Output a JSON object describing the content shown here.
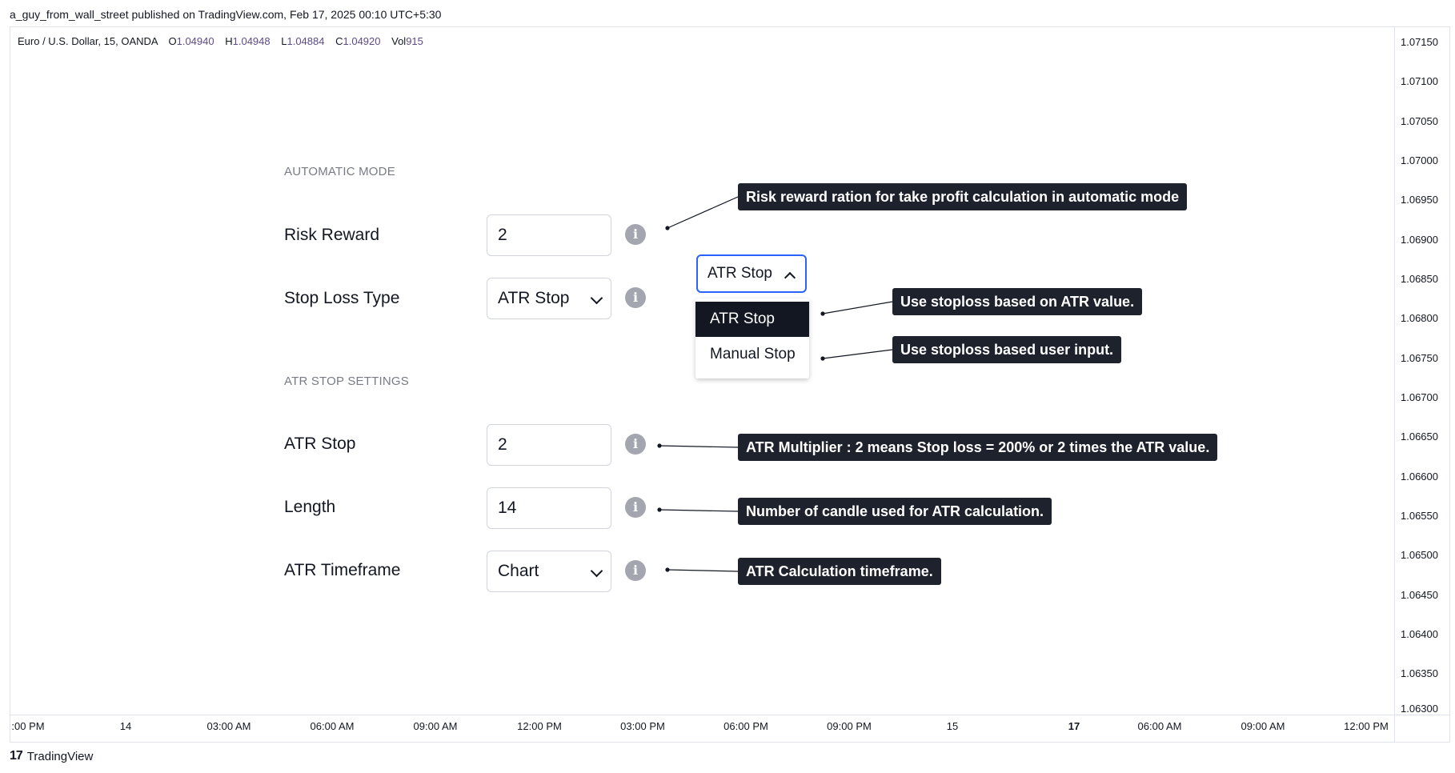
{
  "header": {
    "credit": "a_guy_from_wall_street published on TradingView.com, Feb 17, 2025 00:10 UTC+5:30"
  },
  "legend": {
    "symbol": "Euro / U.S. Dollar, 15, OANDA",
    "o_key": "O",
    "o_val": "1.04940",
    "h_key": "H",
    "h_val": "1.04948",
    "l_key": "L",
    "l_val": "1.04884",
    "c_key": "C",
    "c_val": "1.04920",
    "vol_key": "Vol",
    "vol_val": "915"
  },
  "price_axis": [
    "1.07150",
    "1.07100",
    "1.07050",
    "1.07000",
    "1.06950",
    "1.06900",
    "1.06850",
    "1.06800",
    "1.06750",
    "1.06700",
    "1.06650",
    "1.06600",
    "1.06550",
    "1.06500",
    "1.06450",
    "1.06400",
    "1.06350",
    "1.06300"
  ],
  "time_axis": [
    {
      "label": ":00 PM",
      "bold": false
    },
    {
      "label": "14",
      "bold": false
    },
    {
      "label": "03:00 AM",
      "bold": false
    },
    {
      "label": "06:00 AM",
      "bold": false
    },
    {
      "label": "09:00 AM",
      "bold": false
    },
    {
      "label": "12:00 PM",
      "bold": false
    },
    {
      "label": "03:00 PM",
      "bold": false
    },
    {
      "label": "06:00 PM",
      "bold": false
    },
    {
      "label": "09:00 PM",
      "bold": false
    },
    {
      "label": "15",
      "bold": false
    },
    {
      "label": "17",
      "bold": true
    },
    {
      "label": "06:00 AM",
      "bold": false
    },
    {
      "label": "09:00 AM",
      "bold": false
    },
    {
      "label": "12:00 PM",
      "bold": false
    }
  ],
  "brand": {
    "logo": "17",
    "name": "TradingView"
  },
  "settings": {
    "automatic_mode_heading": "AUTOMATIC MODE",
    "risk_reward": {
      "label": "Risk Reward",
      "value": "2"
    },
    "stop_loss_type": {
      "label": "Stop Loss Type",
      "value": "ATR Stop"
    },
    "atr_settings_heading": "ATR STOP SETTINGS",
    "atr_stop": {
      "label": "ATR Stop",
      "value": "2"
    },
    "length": {
      "label": "Length",
      "value": "14"
    },
    "atr_timeframe": {
      "label": "ATR Timeframe",
      "value": "Chart"
    },
    "info_glyph": "i"
  },
  "dropdown": {
    "selected": "ATR Stop",
    "options": [
      "ATR Stop",
      "Manual Stop"
    ]
  },
  "callouts": {
    "risk_reward": "Risk reward ration for take profit calculation in automatic mode",
    "atr_option": "Use stoploss based on ATR value.",
    "manual_option": "Use stoploss based user input.",
    "atr_multiplier": "ATR Multiplier : 2 means Stop loss = 200% or 2 times the ATR value.",
    "length": "Number of candle used for ATR calculation.",
    "timeframe": "ATR Calculation timeframe."
  },
  "colors": {
    "accent": "#2962ff",
    "callout_bg": "#1e222d",
    "legend_value": "#5b4b8a"
  }
}
